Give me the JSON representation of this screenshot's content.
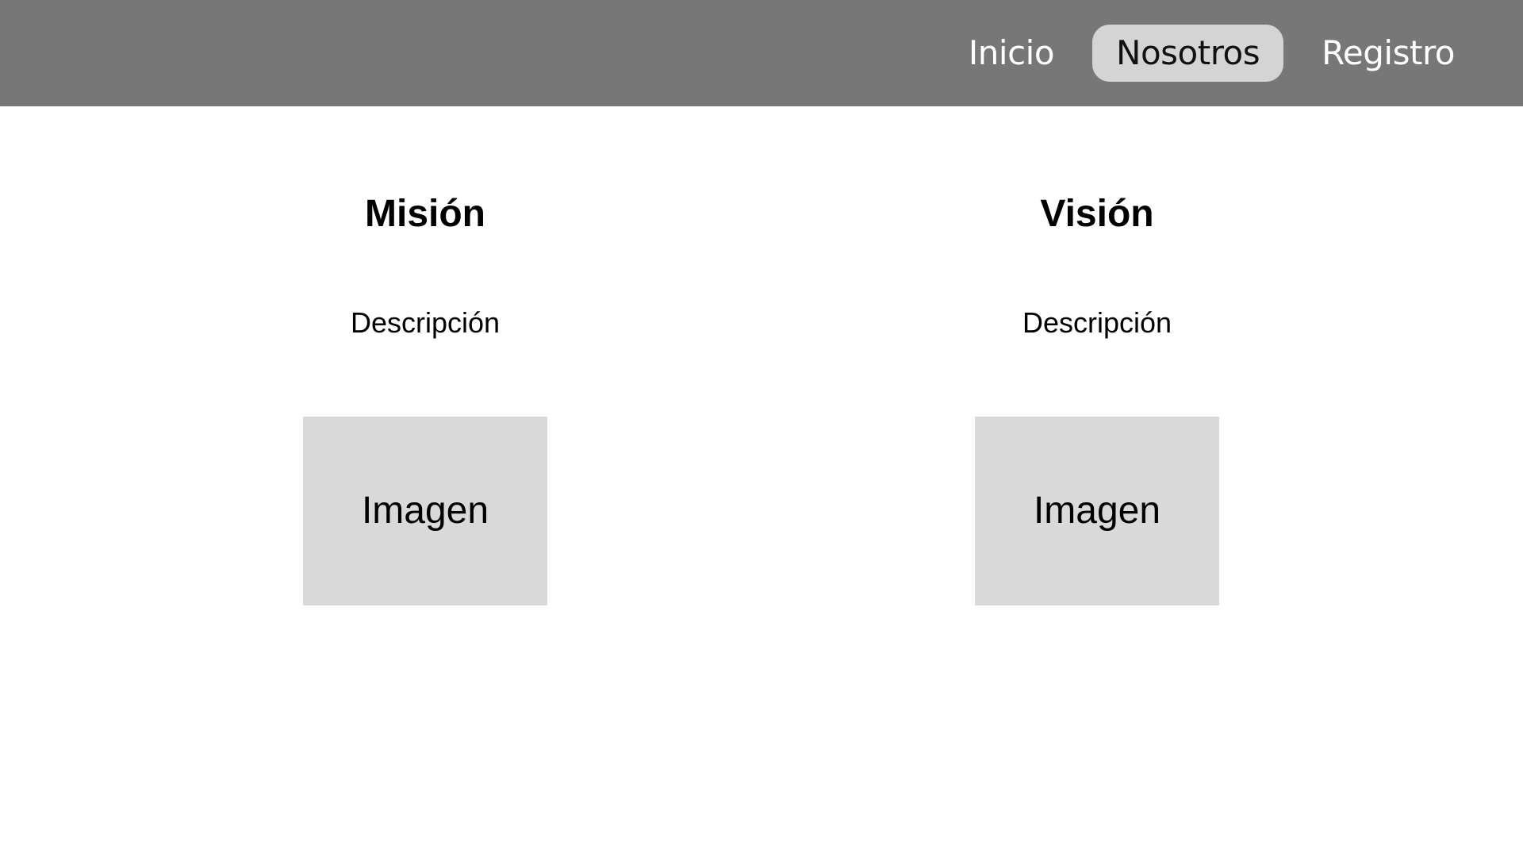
{
  "nav": {
    "items": [
      {
        "label": "Inicio",
        "active": false
      },
      {
        "label": "Nosotros",
        "active": true
      },
      {
        "label": "Registro",
        "active": false
      }
    ]
  },
  "main": {
    "columns": [
      {
        "title": "Misión",
        "description": "Descripción",
        "image_label": "Imagen"
      },
      {
        "title": "Visión",
        "description": "Descripción",
        "image_label": "Imagen"
      }
    ]
  },
  "colors": {
    "header_bg": "#777777",
    "active_nav_bg": "#d4d4d4",
    "image_placeholder_bg": "#d9d9d9"
  }
}
